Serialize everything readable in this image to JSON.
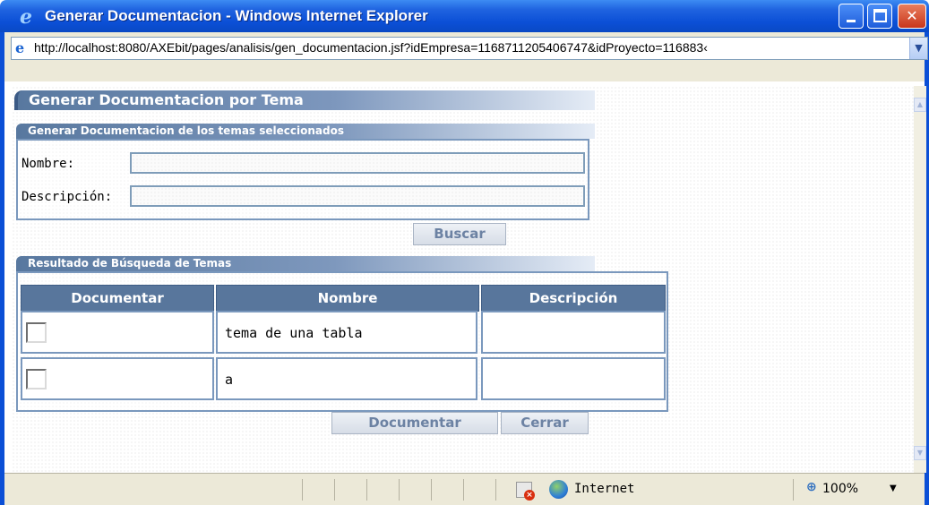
{
  "window": {
    "title": "Generar Documentacion - Windows Internet Explorer",
    "address": "http://localhost:8080/AXEbit/pages/analisis/gen_documentacion.jsf?idEmpresa=1168711205406747&idProyecto=116883‹"
  },
  "page": {
    "title": "Generar Documentacion por Tema",
    "search_section": {
      "title": "Generar Documentacion de los temas seleccionados",
      "nombre_label": "Nombre:",
      "nombre_value": "",
      "descripcion_label": "Descripción:",
      "descripcion_value": "",
      "search_button": "Buscar"
    },
    "results_section": {
      "title": "Resultado de Búsqueda de Temas",
      "columns": [
        "Documentar",
        "Nombre",
        "Descripción"
      ],
      "rows": [
        {
          "documentar": false,
          "nombre": "tema de una tabla",
          "descripcion": ""
        },
        {
          "documentar": false,
          "nombre": "a",
          "descripcion": ""
        }
      ]
    },
    "actions": {
      "documentar_button": "Documentar",
      "cerrar_button": "Cerrar"
    }
  },
  "statusbar": {
    "zone": "Internet",
    "zoom": "100%"
  },
  "icons": {
    "app": "internet-explorer-icon",
    "page": "ie-page-icon",
    "blocked": "popup-blocked-icon",
    "zone": "globe-icon",
    "zoom": "zoom-icon"
  }
}
